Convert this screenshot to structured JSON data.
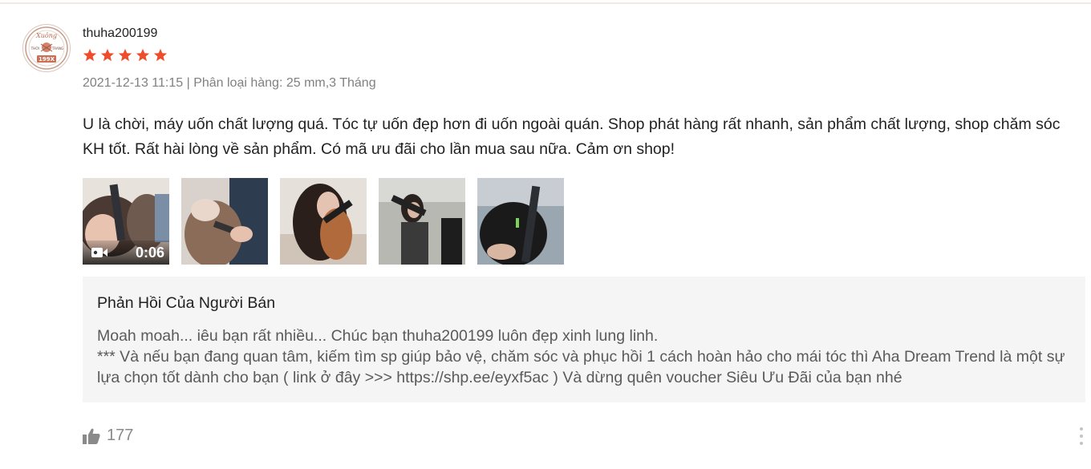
{
  "review": {
    "avatar_text": {
      "script": "Xuông",
      "left": "THỜI",
      "right": "TRANG",
      "year": "199X"
    },
    "username": "thuha200199",
    "rating": 5,
    "meta": "2021-12-13 11:15 | Phân loại hàng: 25 mm,3 Tháng",
    "text": "U là chời, máy uốn chất lượng quá. Tóc tự uốn đẹp hơn đi uốn ngoài quán. Shop phát hàng rất nhanh, sản phẩm chất lượng, shop chăm sóc KH tốt. Rất hài lòng về sản phẩm. Có mã ưu đãi cho lần mua sau nữa. Cảm ơn shop!",
    "media": {
      "video_duration": "0:06",
      "video_icon": "video-camera-icon",
      "thumbnail_count": 5
    },
    "seller_reply": {
      "title": "Phản Hồi Của Người Bán",
      "line1": "Moah moah... iêu bạn rất nhiều... Chúc bạn thuha200199 luôn đẹp xinh lung linh.",
      "line2": "*** Và nếu bạn đang quan tâm, kiếm tìm sp giúp bảo vệ, chăm sóc và phục hồi 1 cách hoàn hảo cho mái tóc thì Aha Dream Trend là một sự lựa chọn tốt dành cho bạn ( link ở đây >>> https://shp.ee/eyxf5ac ) Và dừng quên voucher Siêu Ưu Đãi của bạn nhé"
    },
    "likes": "177",
    "like_icon": "thumbs-up-icon",
    "more_icon": "more-vertical-icon"
  },
  "colors": {
    "star": "#ee4d2d",
    "meta": "#808080",
    "reply_bg": "#f5f5f5"
  }
}
